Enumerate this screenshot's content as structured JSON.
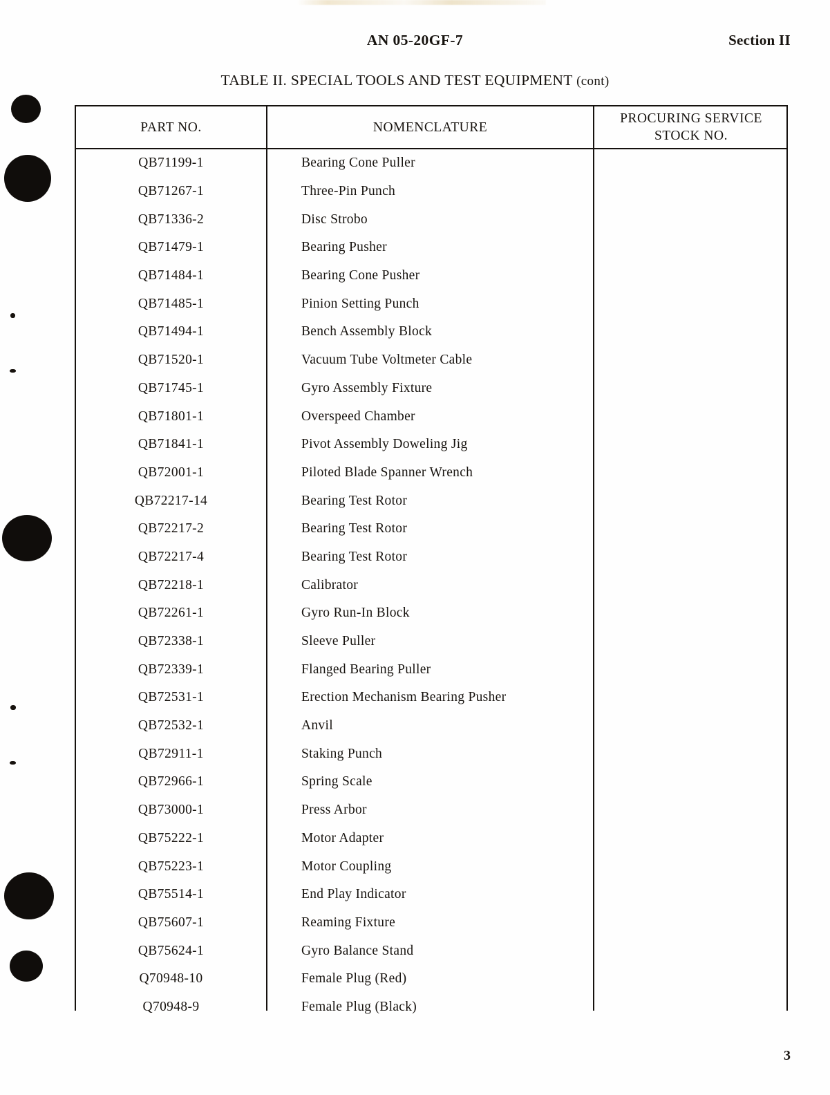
{
  "running_head": {
    "document_number": "AN 05-20GF-7",
    "section": "Section II"
  },
  "caption": {
    "text": "TABLE II.  SPECIAL TOOLS AND TEST EQUIPMENT",
    "continuation": "(cont)"
  },
  "table": {
    "columns": [
      "PART NO.",
      "NOMENCLATURE",
      "PROCURING SERVICE STOCK NO."
    ],
    "column_headers": {
      "part_no": "PART NO.",
      "nomenclature": "NOMENCLATURE",
      "procuring_service_line1": "PROCURING SERVICE",
      "procuring_service_line2": "STOCK NO."
    },
    "rows": [
      {
        "part_no": "QB71199-1",
        "nomenclature": "Bearing Cone Puller",
        "stock_no": ""
      },
      {
        "part_no": "QB71267-1",
        "nomenclature": "Three-Pin Punch",
        "stock_no": ""
      },
      {
        "part_no": "QB71336-2",
        "nomenclature": "Disc Strobo",
        "stock_no": ""
      },
      {
        "part_no": "QB71479-1",
        "nomenclature": "Bearing Pusher",
        "stock_no": ""
      },
      {
        "part_no": "QB71484-1",
        "nomenclature": "Bearing Cone Pusher",
        "stock_no": ""
      },
      {
        "part_no": "QB71485-1",
        "nomenclature": "Pinion Setting Punch",
        "stock_no": ""
      },
      {
        "part_no": "QB71494-1",
        "nomenclature": "Bench Assembly Block",
        "stock_no": ""
      },
      {
        "part_no": "QB71520-1",
        "nomenclature": "Vacuum Tube Voltmeter Cable",
        "stock_no": ""
      },
      {
        "part_no": "QB71745-1",
        "nomenclature": "Gyro Assembly Fixture",
        "stock_no": ""
      },
      {
        "part_no": "QB71801-1",
        "nomenclature": "Overspeed Chamber",
        "stock_no": ""
      },
      {
        "part_no": "QB71841-1",
        "nomenclature": "Pivot Assembly Doweling Jig",
        "stock_no": ""
      },
      {
        "part_no": "QB72001-1",
        "nomenclature": "Piloted Blade Spanner Wrench",
        "stock_no": ""
      },
      {
        "part_no": "QB72217-14",
        "nomenclature": "Bearing Test Rotor",
        "stock_no": ""
      },
      {
        "part_no": "QB72217-2",
        "nomenclature": "Bearing Test Rotor",
        "stock_no": ""
      },
      {
        "part_no": "QB72217-4",
        "nomenclature": "Bearing Test Rotor",
        "stock_no": ""
      },
      {
        "part_no": "QB72218-1",
        "nomenclature": "Calibrator",
        "stock_no": ""
      },
      {
        "part_no": "QB72261-1",
        "nomenclature": "Gyro Run-In Block",
        "stock_no": ""
      },
      {
        "part_no": "QB72338-1",
        "nomenclature": "Sleeve Puller",
        "stock_no": ""
      },
      {
        "part_no": "QB72339-1",
        "nomenclature": "Flanged Bearing Puller",
        "stock_no": ""
      },
      {
        "part_no": "QB72531-1",
        "nomenclature": "Erection Mechanism Bearing Pusher",
        "stock_no": ""
      },
      {
        "part_no": "QB72532-1",
        "nomenclature": "Anvil",
        "stock_no": ""
      },
      {
        "part_no": "QB72911-1",
        "nomenclature": "Staking Punch",
        "stock_no": ""
      },
      {
        "part_no": "QB72966-1",
        "nomenclature": "Spring Scale",
        "stock_no": ""
      },
      {
        "part_no": "QB73000-1",
        "nomenclature": "Press Arbor",
        "stock_no": ""
      },
      {
        "part_no": "QB75222-1",
        "nomenclature": "Motor Adapter",
        "stock_no": ""
      },
      {
        "part_no": "QB75223-1",
        "nomenclature": "Motor Coupling",
        "stock_no": ""
      },
      {
        "part_no": "QB75514-1",
        "nomenclature": "End Play Indicator",
        "stock_no": ""
      },
      {
        "part_no": "QB75607-1",
        "nomenclature": "Reaming Fixture",
        "stock_no": ""
      },
      {
        "part_no": "QB75624-1",
        "nomenclature": "Gyro Balance Stand",
        "stock_no": ""
      },
      {
        "part_no": "Q70948-10",
        "nomenclature": "Female Plug (Red)",
        "stock_no": ""
      },
      {
        "part_no": "Q70948-9",
        "nomenclature": "Female Plug (Black)",
        "stock_no": ""
      }
    ]
  },
  "folio": {
    "page_number": "3"
  },
  "colors": {
    "ink": "#17130f",
    "paper": "#fefefe",
    "rule": "#15110e",
    "artifact": "#100d0b"
  }
}
